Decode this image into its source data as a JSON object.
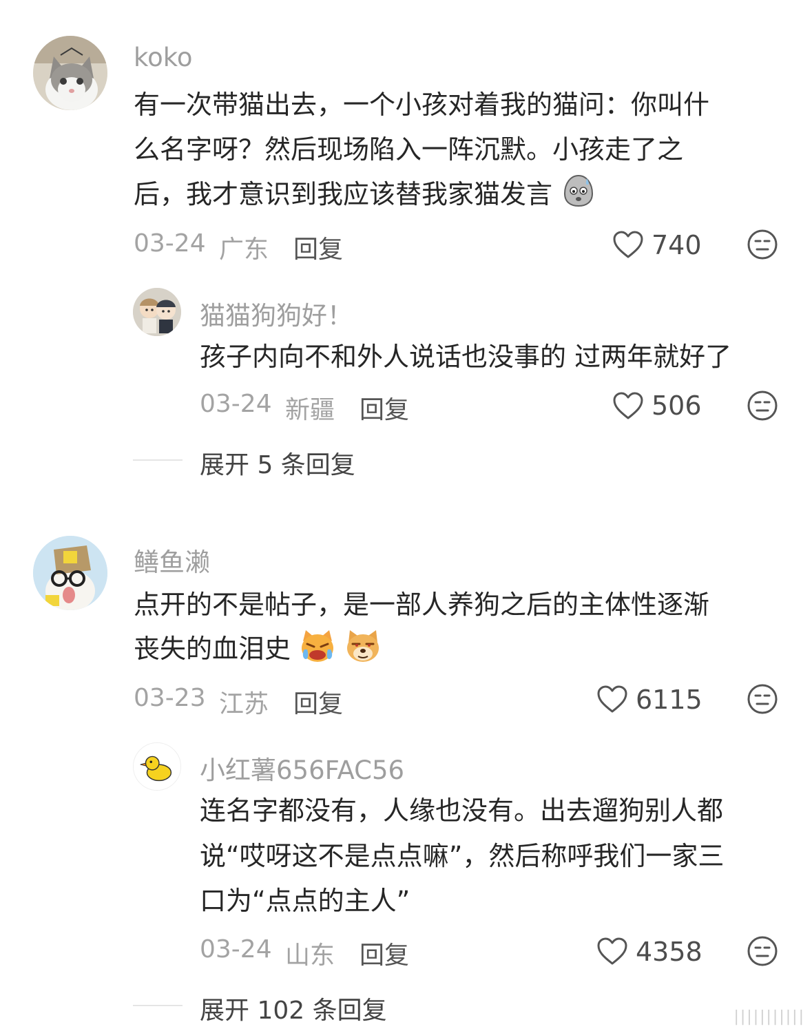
{
  "comments": [
    {
      "username": "koko",
      "lines": [
        "有一次带猫出去，一个小孩对着我的猫问：你叫什",
        "么名字呀？然后现场陷入一阵沉默。小孩走了之",
        "后，我才意识到我应该替我家猫发言"
      ],
      "emoji": "sweat-blob-emoji",
      "date": "03-24",
      "location": "广东",
      "reply_label": "回复",
      "likes": "740",
      "reply": {
        "username": "猫猫狗狗好！",
        "lines": [
          "孩子内向不和外人说话也没事的 过两年就好了"
        ],
        "date": "03-24",
        "location": "新疆",
        "reply_label": "回复",
        "likes": "506"
      },
      "expand_label": "展开 5 条回复"
    },
    {
      "username": "鳝鱼濑",
      "lines": [
        "点开的不是帖子，是一部人养狗之后的主体性逐渐",
        "丧失的血泪史"
      ],
      "emojis": [
        "crying-cat-emoji",
        "smug-dog-emoji"
      ],
      "date": "03-23",
      "location": "江苏",
      "reply_label": "回复",
      "likes": "6115",
      "reply": {
        "username": "小红薯656FAC56",
        "lines": [
          "连名字都没有，人缘也没有。出去遛狗别人都",
          "说“哎呀这不是点点嘛”，然后称呼我们一家三",
          "口为“点点的主人”"
        ],
        "date": "03-24",
        "location": "山东",
        "reply_label": "回复",
        "likes": "4358"
      },
      "expand_label": "展开 102 条回复"
    }
  ],
  "watermark": "|||||||||||"
}
